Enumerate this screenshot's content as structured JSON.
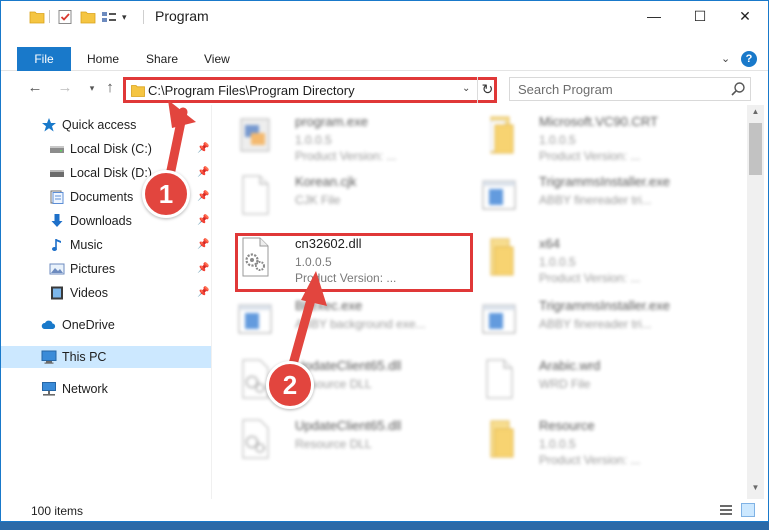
{
  "window": {
    "title": "Program",
    "controls": {
      "minimize": "—",
      "maximize": "☐",
      "close": "✕"
    }
  },
  "ribbon": {
    "tabs": [
      "File",
      "Home",
      "Share",
      "View"
    ],
    "help_label": "?"
  },
  "navigation": {
    "address": "C:\\Program Files\\Program Directory",
    "search_placeholder": "Search Program"
  },
  "sidebar": {
    "items": [
      {
        "label": "Quick access",
        "icon": "star-icon",
        "pinned": false
      },
      {
        "label": "Local Disk (C:)",
        "icon": "drive-icon",
        "pinned": true
      },
      {
        "label": "Local Disk (D:)",
        "icon": "drive-icon",
        "pinned": true
      },
      {
        "label": "Documents",
        "icon": "documents-icon",
        "pinned": true
      },
      {
        "label": "Downloads",
        "icon": "download-icon",
        "pinned": true
      },
      {
        "label": "Music",
        "icon": "music-icon",
        "pinned": true
      },
      {
        "label": "Pictures",
        "icon": "pictures-icon",
        "pinned": true
      },
      {
        "label": "Videos",
        "icon": "videos-icon",
        "pinned": true
      },
      {
        "label": "OneDrive",
        "icon": "cloud-icon",
        "pinned": false
      },
      {
        "label": "This PC",
        "icon": "computer-icon",
        "pinned": false,
        "selected": true
      },
      {
        "label": "Network",
        "icon": "network-icon",
        "pinned": false
      }
    ]
  },
  "files": [
    {
      "name": "program.exe",
      "line2": "1.0.0.5",
      "line3": "Product Version: ...",
      "icon": "exe-icon",
      "blurred": true
    },
    {
      "name": "Microsoft.VC90.CRT",
      "line2": "1.0.0.5",
      "line3": "Product Version: ...",
      "icon": "folder-icon",
      "blurred": true
    },
    {
      "name": "Korean.cjk",
      "line2": "CJK File",
      "line3": "",
      "icon": "file-icon",
      "blurred": true
    },
    {
      "name": "TrigrammsInstaller.exe",
      "line2": "ABBY finereader tri...",
      "line3": "",
      "icon": "app-window-icon",
      "blurred": true
    },
    {
      "name": "cn32602.dll",
      "line2": "1.0.0.5",
      "line3": "Product Version: ...",
      "icon": "dll-gear-icon",
      "blurred": false
    },
    {
      "name": "x64",
      "line2": "1.0.0.5",
      "line3": "Product Version: ...",
      "icon": "folder-icon",
      "blurred": true
    },
    {
      "name": "Bkexec.exe",
      "line2": "ABBY background exe...",
      "line3": "",
      "icon": "app-window-icon",
      "blurred": true
    },
    {
      "name": "TrigrammsInstaller.exe",
      "line2": "ABBY finereader tri...",
      "line3": "",
      "icon": "app-window-icon",
      "blurred": true
    },
    {
      "name": "UpdateClient65.dll",
      "line2": "Resource DLL",
      "line3": "",
      "icon": "dll-gear-icon",
      "blurred": true
    },
    {
      "name": "Arabic.wrd",
      "line2": "WRD File",
      "line3": "",
      "icon": "file-icon",
      "blurred": true
    },
    {
      "name": "UpdateClient65.dll",
      "line2": "Resource DLL",
      "line3": "",
      "icon": "dll-gear-icon",
      "blurred": true
    },
    {
      "name": "Resource",
      "line2": "1.0.0.5",
      "line3": "Product Version: ...",
      "icon": "folder-icon",
      "blurred": true
    }
  ],
  "status": {
    "item_count": "100 items"
  },
  "annotations": {
    "step1": "1",
    "step2": "2"
  },
  "colors": {
    "accent": "#1979ca",
    "annotation_red": "#e2453e",
    "highlight_border": "#e03838",
    "selection": "#cce8ff"
  }
}
